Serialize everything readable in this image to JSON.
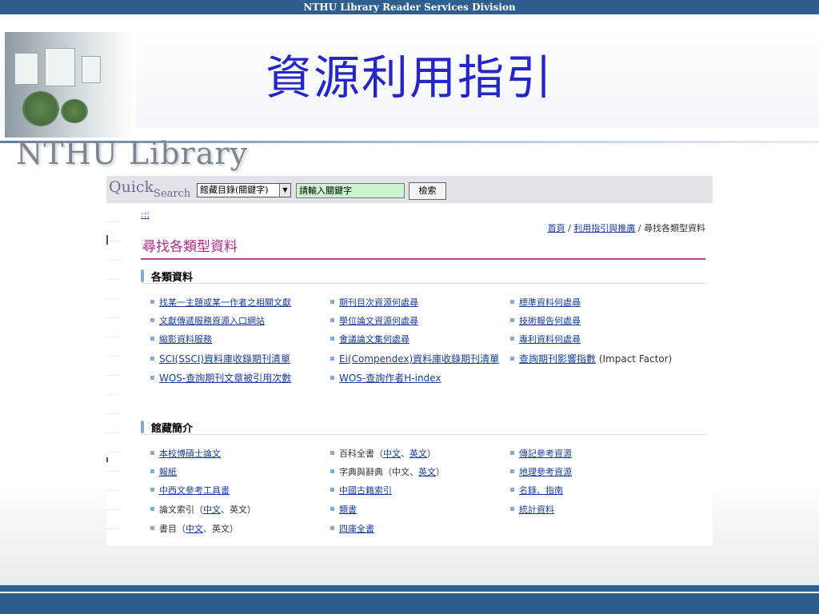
{
  "header": {
    "bar_title": "NTHU Library Reader Services Division",
    "title": "資源利用指引"
  },
  "logo": {
    "text": "NTHU Library"
  },
  "quick_search": {
    "logo_quick": "Quick",
    "logo_search": "Search",
    "select_value": "館藏目錄(關鍵字)",
    "input_value": "請輸入關鍵字",
    "button_label": "檢索"
  },
  "page": {
    "skip_link": ":::",
    "breadcrumb": {
      "home": "首頁",
      "sep1": "/",
      "guide": "利用指引與推廣",
      "sep2": "/",
      "current": "尋找各類型資料"
    },
    "heading": "尋找各類型資料"
  },
  "section1": {
    "title": "各類資料",
    "col1": [
      "找某一主題或某一作者之相關文獻",
      "文獻傳遞服務資源入口網站",
      "縮影資料服務",
      "SCI(SSCI)資料庫收錄期刊清單",
      "WOS-查詢期刊文章被引用次數"
    ],
    "col2": [
      "期刊目次資源何處尋",
      "學位論文資源何處尋",
      "會議論文集何處尋",
      "Ei(Compendex)資料庫收錄期刊清單",
      "WOS-查詢作者H-index"
    ],
    "col3": [
      "標準資料何處尋",
      "技術報告何處尋",
      "專利資料何處尋",
      "查詢期刊影響指數"
    ],
    "col3_suffix": " (Impact Factor)"
  },
  "section2": {
    "title": "館藏簡介",
    "col1": {
      "thesis": "本校博碩士論文",
      "newspaper": "報紙",
      "reference_tools": "中西文參考工具書",
      "index_prefix": "論文索引（",
      "index_zh": "中文",
      "index_mid": "、英文）",
      "bib_prefix": "書目（",
      "bib_zh": "中文",
      "bib_mid": "、英文）"
    },
    "col2": {
      "ency_prefix": "百科全書（",
      "ency_zh": "中文",
      "ency_sep": "、",
      "ency_en": "英文",
      "ency_suffix": "）",
      "dict_prefix": "字典與辭典（中文、",
      "dict_en": "英文",
      "dict_suffix": "）",
      "ancient_index": "中國古籍索引",
      "leishu": "類書",
      "siku": "四庫全書"
    },
    "col3": [
      "傳記參考資源",
      "地理參考資源",
      "名錄、指南",
      "統計資料"
    ]
  },
  "colors": {
    "accent_blue": "#2e5f8e",
    "title_blue": "#2525c8",
    "heading_magenta": "#b02a8a",
    "link_blue": "#1a3d99"
  }
}
